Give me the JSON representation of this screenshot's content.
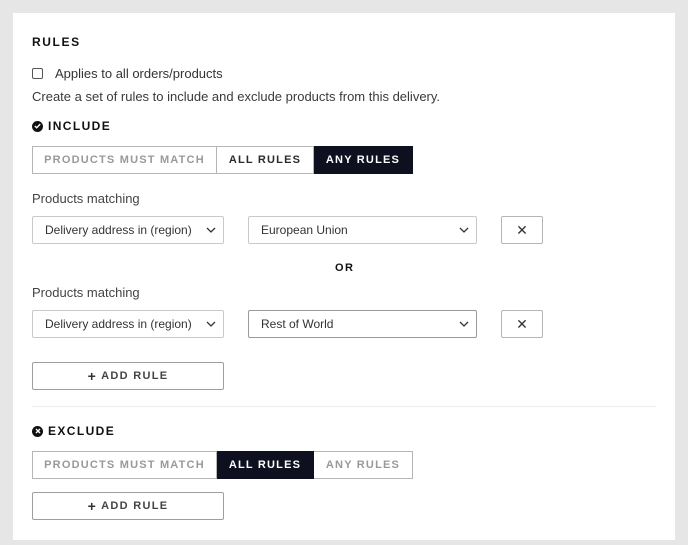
{
  "title": "RULES",
  "applies_all": {
    "label": "Applies to all orders/products",
    "checked": false
  },
  "description": "Create a set of rules to include and exclude products from this delivery.",
  "include": {
    "heading": "INCLUDE",
    "icon": "check-circle-icon",
    "segments": [
      "PRODUCTS MUST MATCH",
      "ALL RULES",
      "ANY RULES"
    ],
    "selected_segment": "ANY RULES",
    "rules": [
      {
        "label": "Products matching",
        "condition": "Delivery address in (region)",
        "value": "European Union",
        "remove": "✕"
      },
      {
        "label": "Products matching",
        "condition": "Delivery address in (region)",
        "value": "Rest of World",
        "remove": "✕"
      }
    ],
    "separator": "OR",
    "add_rule": "ADD RULE"
  },
  "exclude": {
    "heading": "EXCLUDE",
    "icon": "x-circle-icon",
    "segments": [
      "PRODUCTS MUST MATCH",
      "ALL RULES",
      "ANY RULES"
    ],
    "selected_segment": "ALL RULES",
    "add_rule": "ADD RULE"
  },
  "colors": {
    "active_segment": "#0e0f1f",
    "background": "#e6e6e6",
    "card": "#ffffff"
  }
}
